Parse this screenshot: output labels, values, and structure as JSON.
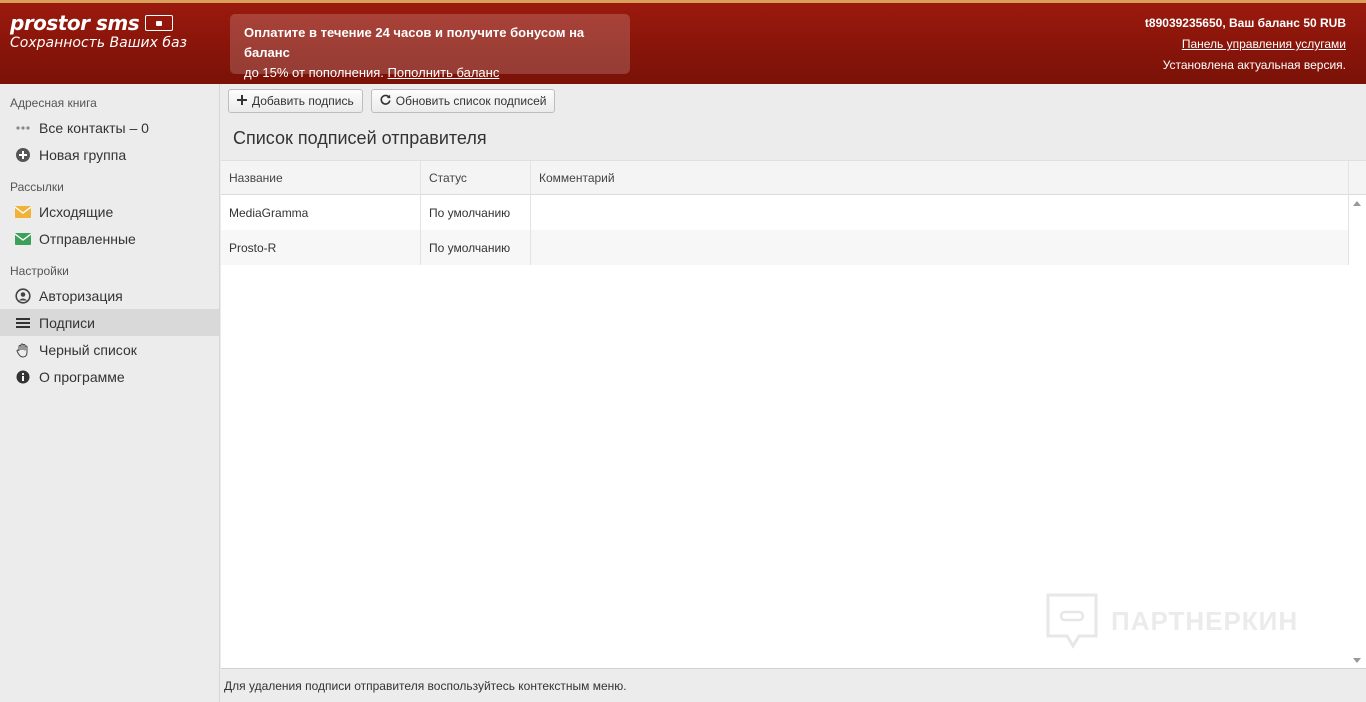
{
  "header": {
    "logo_line1": "prostor sms",
    "logo_line2": "Сохранность Ваших баз",
    "promo_text": "Оплатите в течение 24 часов и получите бонусом на баланс",
    "promo_text2": "до 15% от пополнения.",
    "promo_link": "Пополнить баланс",
    "account_balance": "t89039235650, Ваш баланс 50 RUB",
    "services_link": "Панель управления услугами",
    "version_status": "Установлена актуальная версия."
  },
  "sidebar": {
    "address_book_title": "Адресная книга",
    "address_items": [
      {
        "label": "Все контакты – 0",
        "icon": "dots-icon"
      },
      {
        "label": "Новая группа",
        "icon": "plus-circle-icon"
      }
    ],
    "mailing_title": "Рассылки",
    "mailing_items": [
      {
        "label": "Исходящие",
        "icon": "envelope-icon",
        "color": "#f0b23a"
      },
      {
        "label": "Отправленные",
        "icon": "envelope-icon",
        "color": "#3aa05a"
      }
    ],
    "settings_title": "Настройки",
    "settings_items": [
      {
        "label": "Авторизация",
        "icon": "user-circle-icon"
      },
      {
        "label": "Подписи",
        "icon": "list-icon",
        "active": true
      },
      {
        "label": "Черный список",
        "icon": "hand-icon"
      },
      {
        "label": "О программе",
        "icon": "info-icon"
      }
    ]
  },
  "toolbar": {
    "add_label": "Добавить подпись",
    "refresh_label": "Обновить список подписей"
  },
  "main": {
    "title": "Список подписей отправителя",
    "columns": [
      "Название",
      "Статус",
      "Комментарий"
    ],
    "rows": [
      {
        "name": "MediaGramma",
        "status": "По умолчанию",
        "comment": ""
      },
      {
        "name": "Prosto-R",
        "status": "По умолчанию",
        "comment": ""
      }
    ],
    "footer_hint": "Для удаления подписи отправителя воспользуйтесь контекстным меню."
  },
  "watermark": "ПАРТНЕРКИН"
}
